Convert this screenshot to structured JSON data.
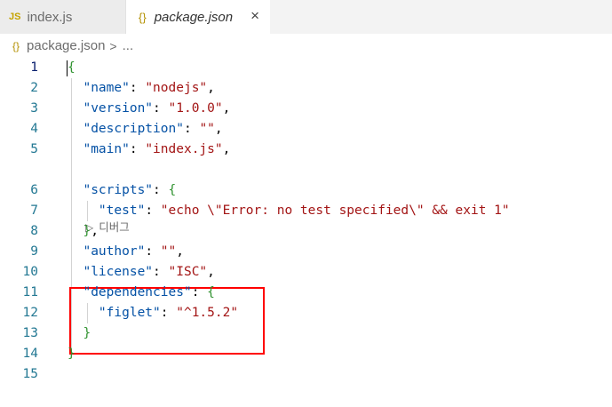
{
  "tabs": [
    {
      "icon": "JS",
      "label": "index.js"
    },
    {
      "icon": "{}",
      "label": "package.json",
      "close": "×"
    }
  ],
  "breadcrumb": {
    "icon": "{}",
    "file": "package.json",
    "separator": ">",
    "rest": "..."
  },
  "codelens": {
    "icon": "▷",
    "label": "디버그"
  },
  "lines": [
    {
      "n": "1",
      "t": [
        [
          "b",
          "{"
        ]
      ]
    },
    {
      "n": "2",
      "t": [
        [
          "p",
          "  "
        ],
        [
          "k",
          "\"name\""
        ],
        [
          "p",
          ": "
        ],
        [
          "s",
          "\"nodejs\""
        ],
        [
          "p",
          ","
        ]
      ]
    },
    {
      "n": "3",
      "t": [
        [
          "p",
          "  "
        ],
        [
          "k",
          "\"version\""
        ],
        [
          "p",
          ": "
        ],
        [
          "s",
          "\"1.0.0\""
        ],
        [
          "p",
          ","
        ]
      ]
    },
    {
      "n": "4",
      "t": [
        [
          "p",
          "  "
        ],
        [
          "k",
          "\"description\""
        ],
        [
          "p",
          ": "
        ],
        [
          "s",
          "\"\""
        ],
        [
          "p",
          ","
        ]
      ]
    },
    {
      "n": "5",
      "t": [
        [
          "p",
          "  "
        ],
        [
          "k",
          "\"main\""
        ],
        [
          "p",
          ": "
        ],
        [
          "s",
          "\"index.js\""
        ],
        [
          "p",
          ","
        ]
      ]
    },
    {
      "n": "6",
      "t": [
        [
          "p",
          "  "
        ],
        [
          "k",
          "\"scripts\""
        ],
        [
          "p",
          ": "
        ],
        [
          "b",
          "{"
        ]
      ]
    },
    {
      "n": "7",
      "t": [
        [
          "p",
          "    "
        ],
        [
          "k",
          "\"test\""
        ],
        [
          "p",
          ": "
        ],
        [
          "s",
          "\"echo \\\"Error: no test specified\\\" && exit 1\""
        ]
      ]
    },
    {
      "n": "8",
      "t": [
        [
          "p",
          "  "
        ],
        [
          "b",
          "}"
        ],
        [
          "p",
          ","
        ]
      ]
    },
    {
      "n": "9",
      "t": [
        [
          "p",
          "  "
        ],
        [
          "k",
          "\"author\""
        ],
        [
          "p",
          ": "
        ],
        [
          "s",
          "\"\""
        ],
        [
          "p",
          ","
        ]
      ]
    },
    {
      "n": "10",
      "t": [
        [
          "p",
          "  "
        ],
        [
          "k",
          "\"license\""
        ],
        [
          "p",
          ": "
        ],
        [
          "s",
          "\"ISC\""
        ],
        [
          "p",
          ","
        ]
      ]
    },
    {
      "n": "11",
      "t": [
        [
          "p",
          "  "
        ],
        [
          "k",
          "\"dependencies\""
        ],
        [
          "p",
          ": "
        ],
        [
          "b",
          "{"
        ]
      ]
    },
    {
      "n": "12",
      "t": [
        [
          "p",
          "    "
        ],
        [
          "k",
          "\"figlet\""
        ],
        [
          "p",
          ": "
        ],
        [
          "s",
          "\"^1.5.2\""
        ]
      ]
    },
    {
      "n": "13",
      "t": [
        [
          "p",
          "  "
        ],
        [
          "b",
          "}"
        ]
      ]
    },
    {
      "n": "14",
      "t": [
        [
          "b",
          "}"
        ]
      ]
    },
    {
      "n": "15",
      "t": []
    }
  ]
}
